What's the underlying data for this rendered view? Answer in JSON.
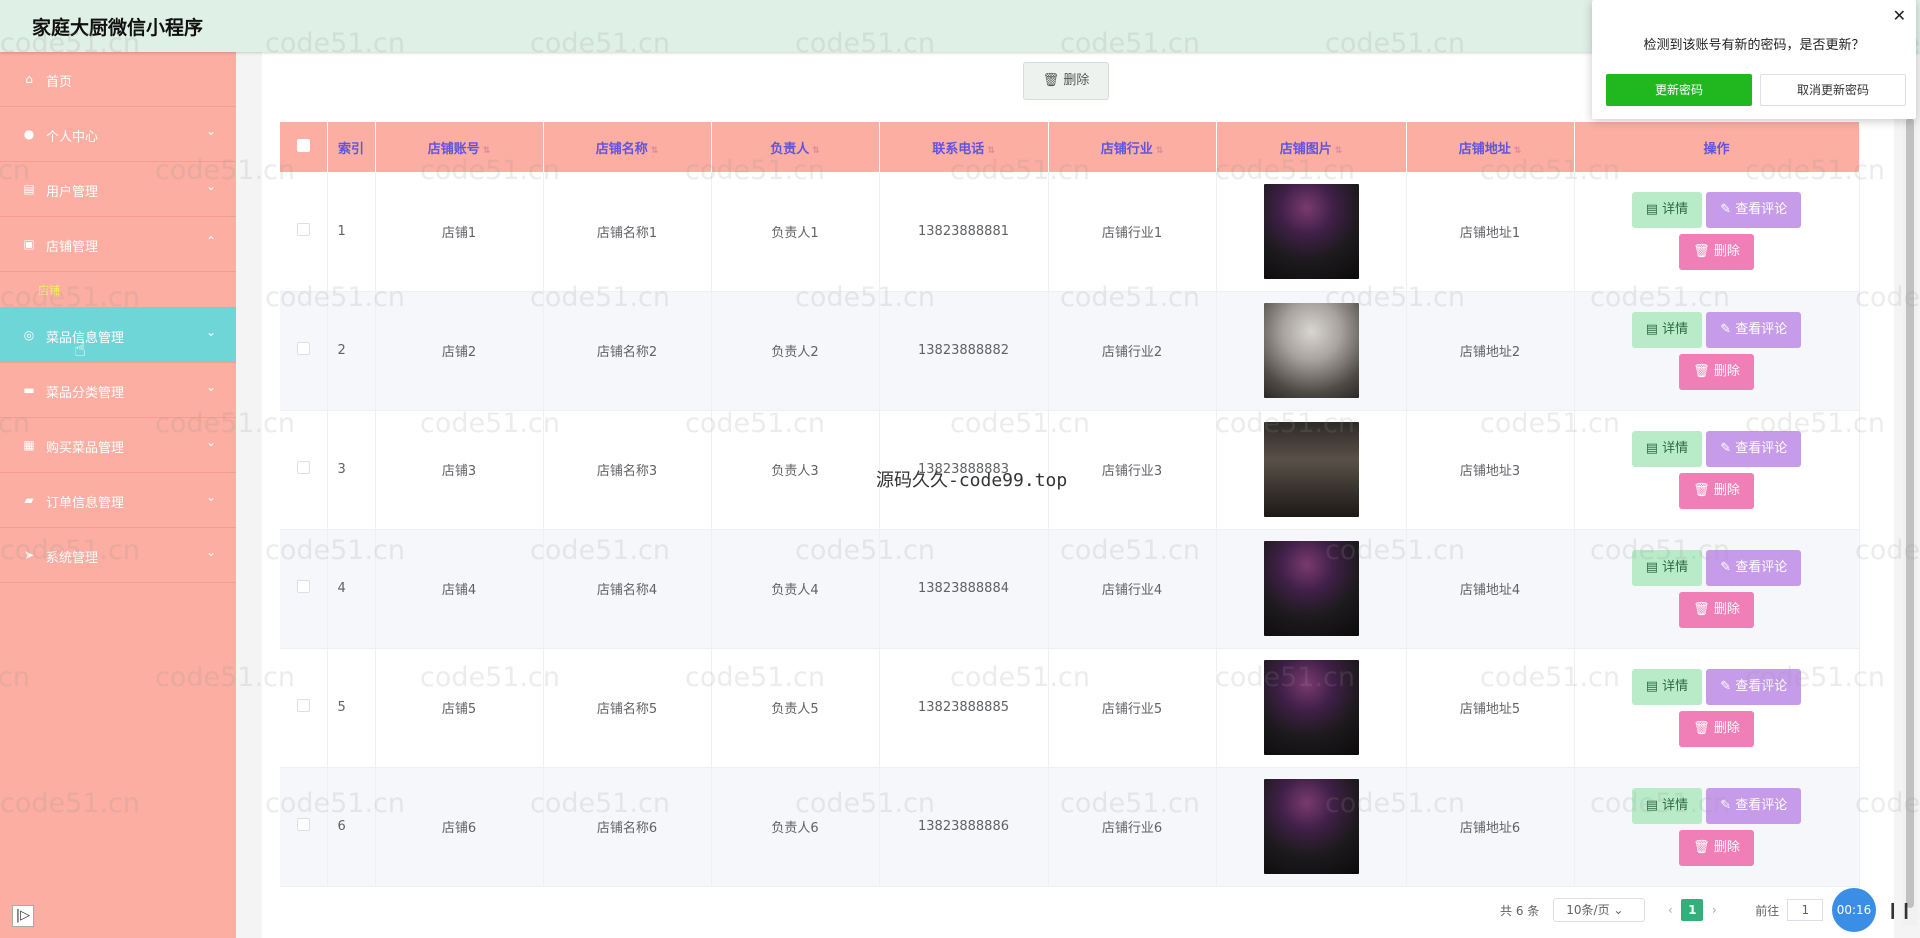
{
  "app_title": "家庭大厨微信小程序",
  "sidebar": {
    "items": [
      {
        "label": "首页",
        "icon": "home-icon",
        "chev": ""
      },
      {
        "label": "个人中心",
        "icon": "user-icon",
        "chev": "⌄"
      },
      {
        "label": "用户管理",
        "icon": "users-icon",
        "chev": "⌄"
      },
      {
        "label": "店铺管理",
        "icon": "store-icon",
        "chev": "⌃"
      },
      {
        "label": "菜品信息管理",
        "icon": "dish-icon",
        "chev": "⌄"
      },
      {
        "label": "菜品分类管理",
        "icon": "category-icon",
        "chev": "⌄"
      },
      {
        "label": "购买菜品管理",
        "icon": "cart-icon",
        "chev": "⌄"
      },
      {
        "label": "订单信息管理",
        "icon": "order-icon",
        "chev": "⌄"
      },
      {
        "label": "系统管理",
        "icon": "system-icon",
        "chev": "⌄"
      }
    ],
    "submenu_label": "店铺",
    "collapse_symbol": "|▷"
  },
  "toolbar": {
    "batch_delete_label": "删除"
  },
  "table": {
    "columns": [
      "索引",
      "店铺账号",
      "店铺名称",
      "负责人",
      "联系电话",
      "店铺行业",
      "店铺图片",
      "店铺地址",
      "操作"
    ],
    "rows": [
      {
        "index": "1",
        "account": "店铺1",
        "name": "店铺名称1",
        "manager": "负责人1",
        "phone": "13823888881",
        "industry": "店铺行业1",
        "address": "店铺地址1",
        "image": "restaurant-night"
      },
      {
        "index": "2",
        "account": "店铺2",
        "name": "店铺名称2",
        "manager": "负责人2",
        "phone": "13823888882",
        "industry": "店铺行业2",
        "address": "店铺地址2",
        "image": "restaurant-hall"
      },
      {
        "index": "3",
        "account": "店铺3",
        "name": "店铺名称3",
        "manager": "负责人3",
        "phone": "13823888883",
        "industry": "店铺行业3",
        "address": "店铺地址3",
        "image": "restaurant-dark"
      },
      {
        "index": "4",
        "account": "店铺4",
        "name": "店铺名称4",
        "manager": "负责人4",
        "phone": "13823888884",
        "industry": "店铺行业4",
        "address": "店铺地址4",
        "image": "restaurant-night"
      },
      {
        "index": "5",
        "account": "店铺5",
        "name": "店铺名称5",
        "manager": "负责人5",
        "phone": "13823888885",
        "industry": "店铺行业5",
        "address": "店铺地址5",
        "image": "restaurant-night"
      },
      {
        "index": "6",
        "account": "店铺6",
        "name": "店铺名称6",
        "manager": "负责人6",
        "phone": "13823888886",
        "industry": "店铺行业6",
        "address": "店铺地址6",
        "image": "restaurant-night"
      }
    ],
    "actions": {
      "detail": "详情",
      "review": "查看评论",
      "delete": "删除"
    }
  },
  "pagination": {
    "total": "共 6 条",
    "page_size": "10条/页",
    "current_page": "1",
    "goto_label": "前往",
    "goto_value": "1"
  },
  "timer": "00:16",
  "dialog": {
    "message": "检测到该账号有新的密码，是否更新？",
    "confirm": "更新密码",
    "cancel": "取消更新密码",
    "close": "✕"
  },
  "watermark_text": "code51.cn",
  "center_watermark": "源码久久-code99.top",
  "colors": {
    "sidebar": "#fbaea1",
    "active_menu": "#6fd6d8",
    "header_text": "#6254e0",
    "confirm": "#20b81e",
    "detail_btn": "#b9ebc9",
    "review_btn": "#c69bea",
    "delete_btn": "#f17fb7"
  }
}
